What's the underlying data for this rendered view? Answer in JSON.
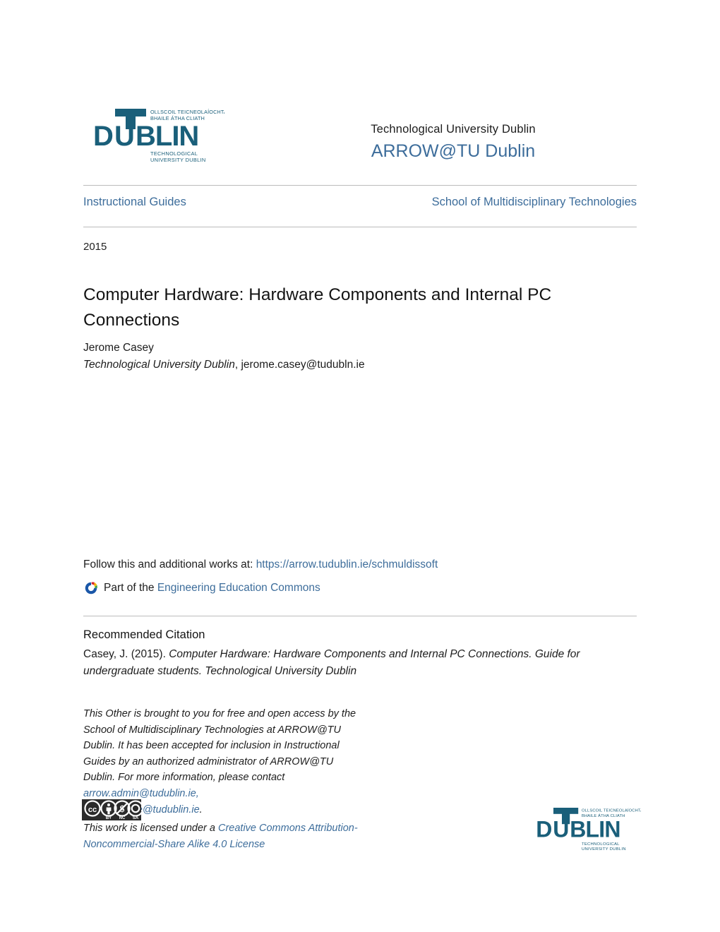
{
  "institution": {
    "name": "Technological University Dublin",
    "repository": "ARROW@TU Dublin",
    "logo": {
      "icon_name": "tu-dublin-logo",
      "wordmark": "DUBLIN",
      "tu_mark": "TU",
      "irish_line1": "OLLSCOIL TEICNEOLAÍOCHTA",
      "irish_line2": "BHAILE ÁTHA CLIATH",
      "english_line1": "TECHNOLOGICAL",
      "english_line2": "UNIVERSITY DUBLIN",
      "color": "#1a5f7a"
    }
  },
  "series": {
    "collection": "Instructional Guides",
    "school": "School of Multidisciplinary Technologies"
  },
  "record": {
    "year": "2015",
    "title": "Computer Hardware: Hardware Components and Internal PC Connections",
    "author": "Jerome Casey",
    "affiliation": "Technological University Dublin",
    "affiliation_separator": ", ",
    "email": "jerome.casey@tudubln.ie"
  },
  "follow": {
    "prefix": "Follow this and additional works at: ",
    "url": "https://arrow.tudublin.ie/schmuldissoft",
    "part_of_prefix": "Part of the ",
    "commons": "Engineering Education Commons",
    "icon_name": "digital-commons-network-icon"
  },
  "citation": {
    "heading": "Recommended Citation",
    "prefix": "Casey, J. (2015). ",
    "italic_part": "Computer Hardware: Hardware Components and Internal PC Connections. Guide for undergraduate students. Technological University Dublin"
  },
  "license": {
    "paragraph_part1": "This Other is brought to you for free and open access by the School of Multidisciplinary Technologies at ARROW@TU Dublin. It has been accepted for inclusion in Instructional Guides by an authorized administrator of ARROW@TU Dublin. For more information, please contact ",
    "email1": "arrow.admin@tudublin.ie,",
    "email2": "aisling.coyne@tudublin.ie",
    "paragraph_end": ".",
    "note_prefix": "This work is licensed under a ",
    "note_link": "Creative Commons Attribution-Noncommercial-Share Alike 4.0 License",
    "badge": {
      "icon_name": "creative-commons-by-nc-sa-badge",
      "cc": "CC",
      "terms": [
        "BY",
        "NC",
        "SA"
      ]
    }
  },
  "colors": {
    "link": "#3d6d9b",
    "accent": "#3d6d9b",
    "logo_teal": "#1a5f7a",
    "rule": "#bcbcbc",
    "text": "#1d1d1d"
  }
}
